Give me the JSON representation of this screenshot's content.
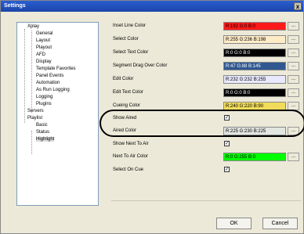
{
  "window": {
    "title": "Settings",
    "close": "x"
  },
  "tree": {
    "xplay": "Xplay",
    "general": "General",
    "layout": "Layout",
    "playout": "Playout",
    "afd": "AFD",
    "display": "Display",
    "template_favorites": "Template Favorites",
    "panel_events": "Panel Events",
    "automation": "Automation",
    "as_run_logging": "As Run Logging",
    "logging": "Logging",
    "plugins": "Plugins",
    "servers": "Servers",
    "playlist": "Playlist",
    "basic": "Basic",
    "status": "Status",
    "highlight": "Highlight"
  },
  "settings": {
    "inset_line_color": {
      "label": "Inset Line Color",
      "value": "R:192 G:0 B:0",
      "color": "#ff1a1a"
    },
    "select_color": {
      "label": "Select Color",
      "value": "R:255 G:236 B:198",
      "color": "#ffecc6"
    },
    "select_text_color": {
      "label": "Select Text Color",
      "value": "R:0 G:0 B:0",
      "color": "#000000"
    },
    "segment_drag_over_color": {
      "label": "Segment Drag Over Color",
      "value": "R:47 G:88 B:145",
      "color": "#2f5891"
    },
    "edit_color": {
      "label": "Edit Color",
      "value": "R:232 G:232 B:255",
      "color": "#e8e8ff"
    },
    "edit_text_color": {
      "label": "Edit Text Color",
      "value": "R:0 G:0 B:0",
      "color": "#000000"
    },
    "cueing_color": {
      "label": "Cueing Color",
      "value": "R:240 G:220 B:90",
      "color": "#f0dc5a"
    },
    "show_aired": {
      "label": "Show Aired",
      "checked": "✓"
    },
    "aired_color": {
      "label": "Aired Color",
      "value": "R:225 G:230 B:225",
      "color": "#e1e6e1"
    },
    "show_next_to_air": {
      "label": "Show Next To Air",
      "checked": "✓"
    },
    "next_to_air_color": {
      "label": "Next To Air Color",
      "value": "R:0 G:255 B:0",
      "color": "#00ff00"
    },
    "select_on_cue": {
      "label": "Select On Cue",
      "checked": "✓"
    }
  },
  "more_button": "...",
  "buttons": {
    "ok": "OK",
    "cancel": "Cancel"
  }
}
